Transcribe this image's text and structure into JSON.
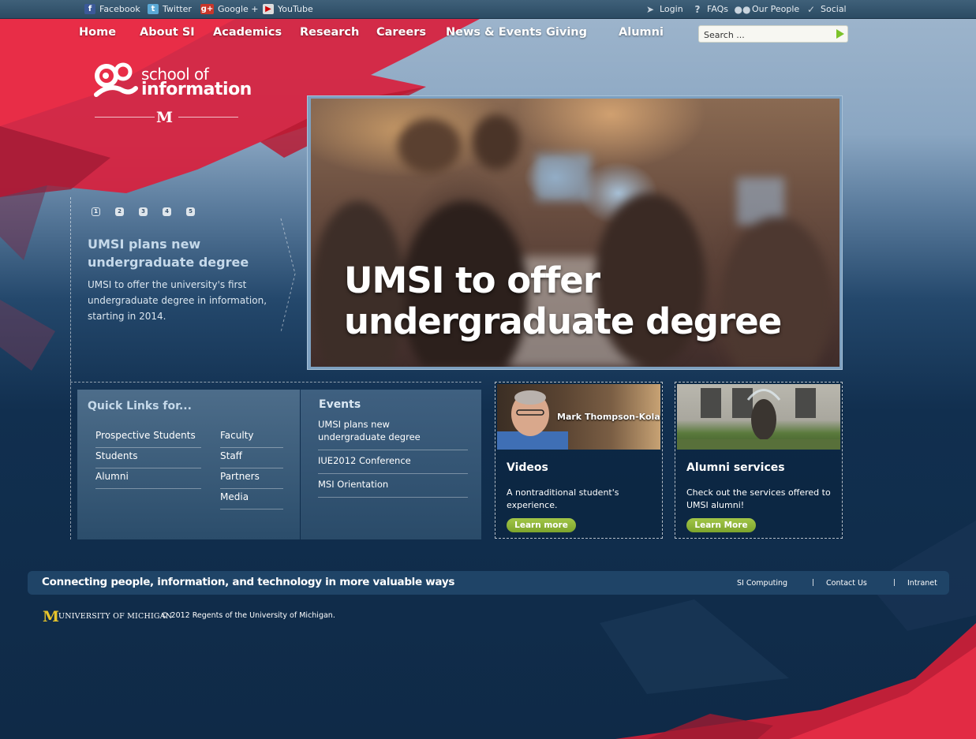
{
  "social_bar": {
    "left": [
      {
        "label": "Facebook",
        "icon": "facebook-icon"
      },
      {
        "label": "Twitter",
        "icon": "twitter-icon"
      },
      {
        "label": "Google +",
        "icon": "google-plus-icon"
      },
      {
        "label": "YouTube",
        "icon": "youtube-icon"
      }
    ],
    "right": [
      {
        "label": "Login",
        "icon": "login-icon"
      },
      {
        "label": "FAQs",
        "icon": "question-icon"
      },
      {
        "label": "Our People",
        "icon": "people-icon"
      },
      {
        "label": "Social",
        "icon": "bird-icon"
      }
    ]
  },
  "nav": [
    "Home",
    "About SI",
    "Academics",
    "Research",
    "Careers",
    "News & Events",
    "Giving",
    "Alumni"
  ],
  "search": {
    "placeholder": "Search ..."
  },
  "logo": {
    "line1": "school of",
    "line2": "information",
    "mark": "M"
  },
  "slider": {
    "pages": [
      "1",
      "2",
      "3",
      "4",
      "5"
    ],
    "active_page": 1,
    "title": "UMSI plans new undergraduate degree",
    "description": "UMSI to offer the university's first undergraduate degree in information, starting in 2014.",
    "hero_caption": "UMSI to offer undergraduate degree"
  },
  "quick_links": {
    "title": "Quick Links for...",
    "col1": [
      "Prospective Students",
      "Students",
      "Alumni"
    ],
    "col2": [
      "Faculty",
      "Staff",
      "Partners",
      "Media"
    ]
  },
  "events": {
    "title": "Events",
    "items": [
      "UMSI plans new undergraduate degree",
      "IUE2012 Conference",
      "MSI Orientation"
    ]
  },
  "cards": [
    {
      "image_caption": "Mark Thompson-Kolar",
      "title": "Videos",
      "description": "A nontraditional student's experience.",
      "button": "Learn more"
    },
    {
      "image_caption": "",
      "title": "Alumni services",
      "description": "Check out the services offered to UMSI alumni!",
      "button": "Learn More"
    }
  ],
  "footer": {
    "tagline": "Connecting people, information, and technology in more valuable ways",
    "links": [
      "SI Computing",
      "Contact Us",
      "Intranet"
    ],
    "separator": "|",
    "university_mark": "M",
    "university_name": "UNIVERSITY OF MICHIGAN",
    "copyright": "© 2012 Regents of the University of Michigan."
  },
  "colors": {
    "accent_red": "#e0243f",
    "button_green": "#8bb336",
    "um_maize": "#e8c52b",
    "navy": "#0f2a47"
  }
}
